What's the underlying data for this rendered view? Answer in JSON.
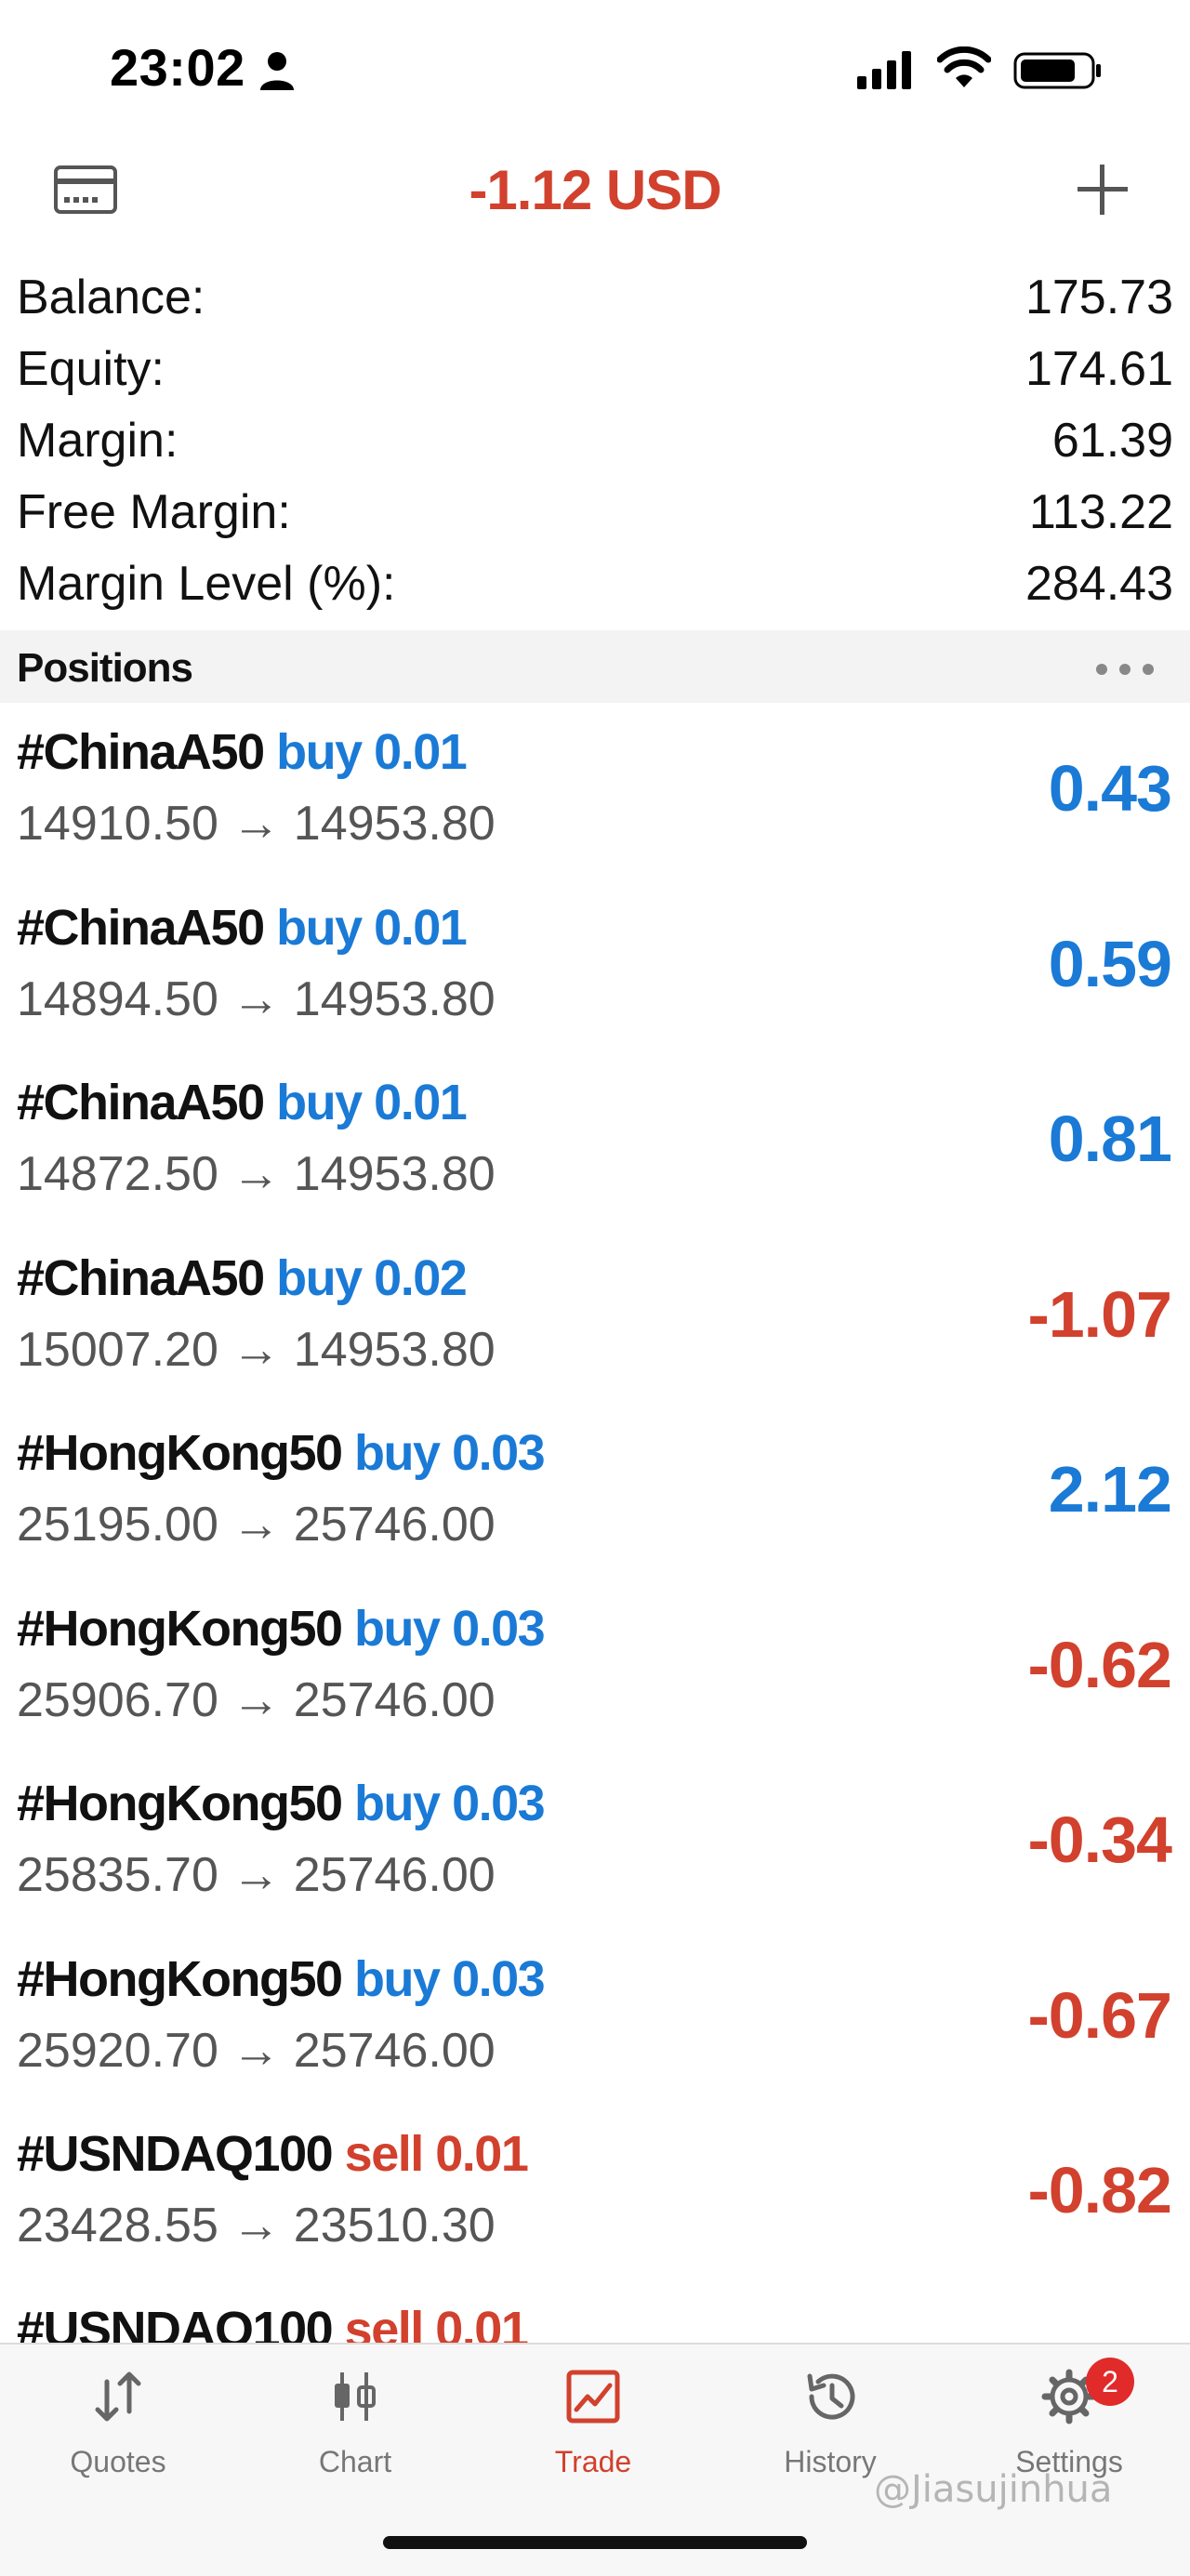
{
  "status_bar": {
    "time": "23:02"
  },
  "header": {
    "title": "-1.12 USD"
  },
  "account": [
    {
      "label": "Balance:",
      "value": "175.73"
    },
    {
      "label": "Equity:",
      "value": "174.61"
    },
    {
      "label": "Margin:",
      "value": "61.39"
    },
    {
      "label": "Free Margin:",
      "value": "113.22"
    },
    {
      "label": "Margin Level (%):",
      "value": "284.43"
    }
  ],
  "positions_section": {
    "title": "Positions"
  },
  "positions": [
    {
      "symbol": "#ChinaA50",
      "side": "buy",
      "volume": "0.01",
      "open_price": "14910.50",
      "current_price": "14953.80",
      "profit": "0.43"
    },
    {
      "symbol": "#ChinaA50",
      "side": "buy",
      "volume": "0.01",
      "open_price": "14894.50",
      "current_price": "14953.80",
      "profit": "0.59"
    },
    {
      "symbol": "#ChinaA50",
      "side": "buy",
      "volume": "0.01",
      "open_price": "14872.50",
      "current_price": "14953.80",
      "profit": "0.81"
    },
    {
      "symbol": "#ChinaA50",
      "side": "buy",
      "volume": "0.02",
      "open_price": "15007.20",
      "current_price": "14953.80",
      "profit": "-1.07"
    },
    {
      "symbol": "#HongKong50",
      "side": "buy",
      "volume": "0.03",
      "open_price": "25195.00",
      "current_price": "25746.00",
      "profit": "2.12"
    },
    {
      "symbol": "#HongKong50",
      "side": "buy",
      "volume": "0.03",
      "open_price": "25906.70",
      "current_price": "25746.00",
      "profit": "-0.62"
    },
    {
      "symbol": "#HongKong50",
      "side": "buy",
      "volume": "0.03",
      "open_price": "25835.70",
      "current_price": "25746.00",
      "profit": "-0.34"
    },
    {
      "symbol": "#HongKong50",
      "side": "buy",
      "volume": "0.03",
      "open_price": "25920.70",
      "current_price": "25746.00",
      "profit": "-0.67"
    },
    {
      "symbol": "#USNDAQ100",
      "side": "sell",
      "volume": "0.01",
      "open_price": "23428.55",
      "current_price": "23510.30",
      "profit": "-0.82"
    },
    {
      "symbol": "#USNDAQ100",
      "side": "sell",
      "volume": "0.01",
      "open_price": "",
      "current_price": "",
      "profit": ""
    }
  ],
  "tabs": [
    {
      "label": "Quotes",
      "icon": "quotes-arrows-icon"
    },
    {
      "label": "Chart",
      "icon": "candlestick-icon"
    },
    {
      "label": "Trade",
      "icon": "trade-chart-icon",
      "active": true
    },
    {
      "label": "History",
      "icon": "history-clock-icon"
    },
    {
      "label": "Settings",
      "icon": "gear-icon",
      "badge": "2"
    }
  ],
  "watermark": "@Jiasujinhua",
  "colors": {
    "loss": "#d1412d",
    "profit": "#1a7ad6",
    "buy": "#1a7ad6",
    "sell": "#d1412d"
  }
}
